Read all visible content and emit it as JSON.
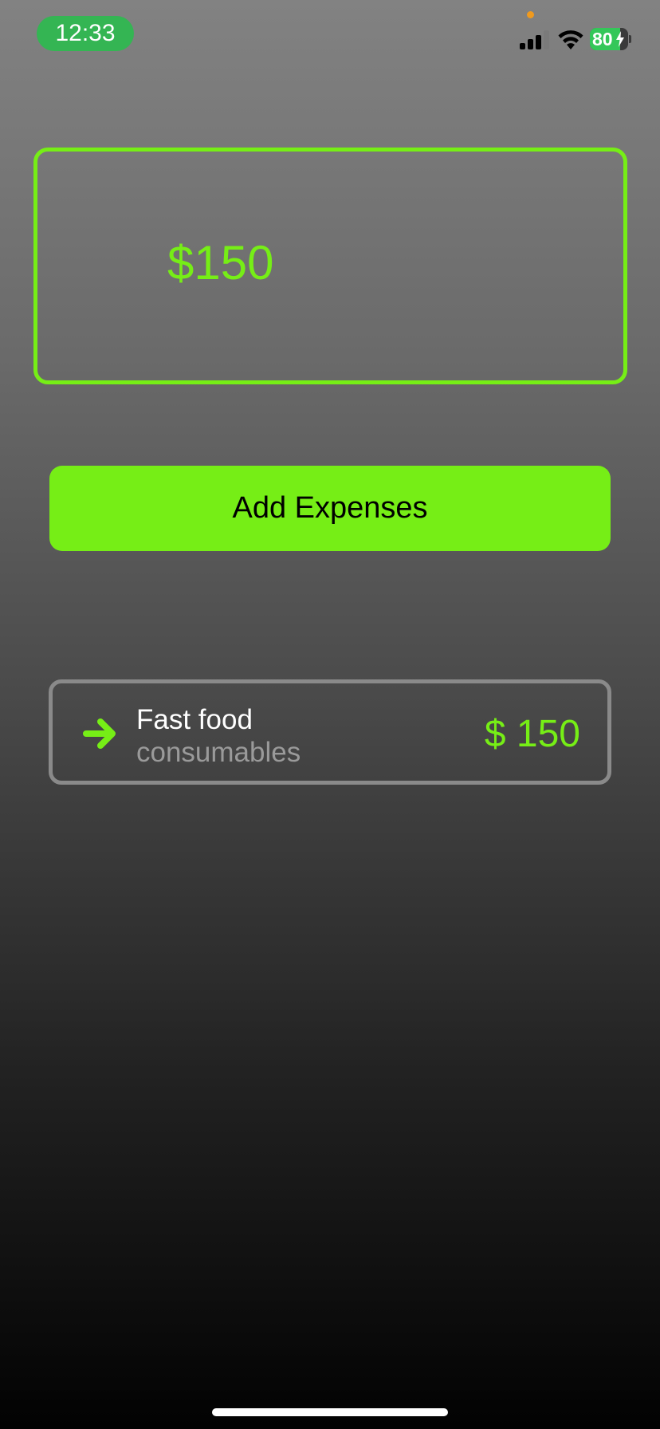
{
  "status_bar": {
    "time": "12:33",
    "battery_level": "80",
    "battery_percent": 80,
    "signal_bars": 3,
    "icons": [
      "signal-icon",
      "wifi-icon",
      "battery-icon",
      "charging-bolt-icon"
    ]
  },
  "balance": {
    "amount": "$150"
  },
  "actions": {
    "add_expenses_label": "Add Expenses"
  },
  "expenses": [
    {
      "title": "Fast food",
      "category": "consumables",
      "amount": "$ 150",
      "icon": "arrow-right-icon"
    }
  ],
  "colors": {
    "accent": "#76ee16",
    "status_pill": "#34b553",
    "battery_green": "#34c759",
    "privacy_dot": "#f09a1e",
    "row_border": "#8a8a8a",
    "category_text": "#9a9a9a"
  }
}
